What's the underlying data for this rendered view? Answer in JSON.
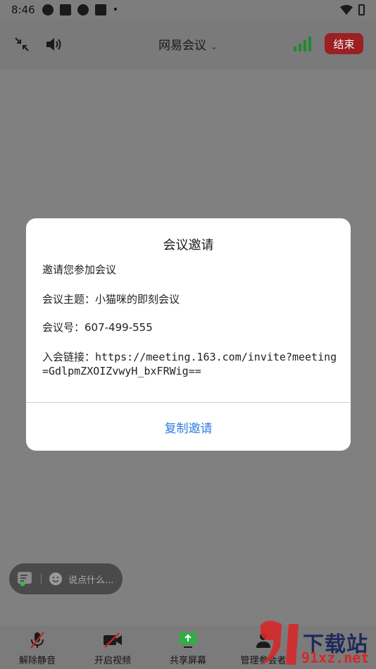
{
  "status_bar": {
    "time": "8:46",
    "dot": "•"
  },
  "toolbar": {
    "meeting_title": "网易会议",
    "chevron": "⌄",
    "end_label": "结束",
    "end_color": "#9c1f22",
    "signal_color": "#1f8a2e"
  },
  "dialog": {
    "title": "会议邀请",
    "invite_text": "邀请您参加会议",
    "topic_label": "会议主题：",
    "topic_value": "小猫咪的即刻会议",
    "number_label": "会议号：",
    "number_value": "607-499-555",
    "link_label": "入会链接：",
    "link_value": "https://meeting.163.com/invite?meeting=GdlpmZXOIZvwyH_bxFRWig==",
    "copy_label": "复制邀请",
    "copy_color": "#2d7fe0"
  },
  "chat": {
    "placeholder": "说点什么..."
  },
  "bottom_bar": {
    "items": [
      {
        "label": "解除静音",
        "icon": "mic-off-icon"
      },
      {
        "label": "开启视频",
        "icon": "video-off-icon"
      },
      {
        "label": "共享屏幕",
        "icon": "share-screen-icon"
      },
      {
        "label": "管理参会者",
        "icon": "participants-icon"
      }
    ]
  },
  "watermark": {
    "brand": "下载站",
    "url": "91xz.net"
  }
}
